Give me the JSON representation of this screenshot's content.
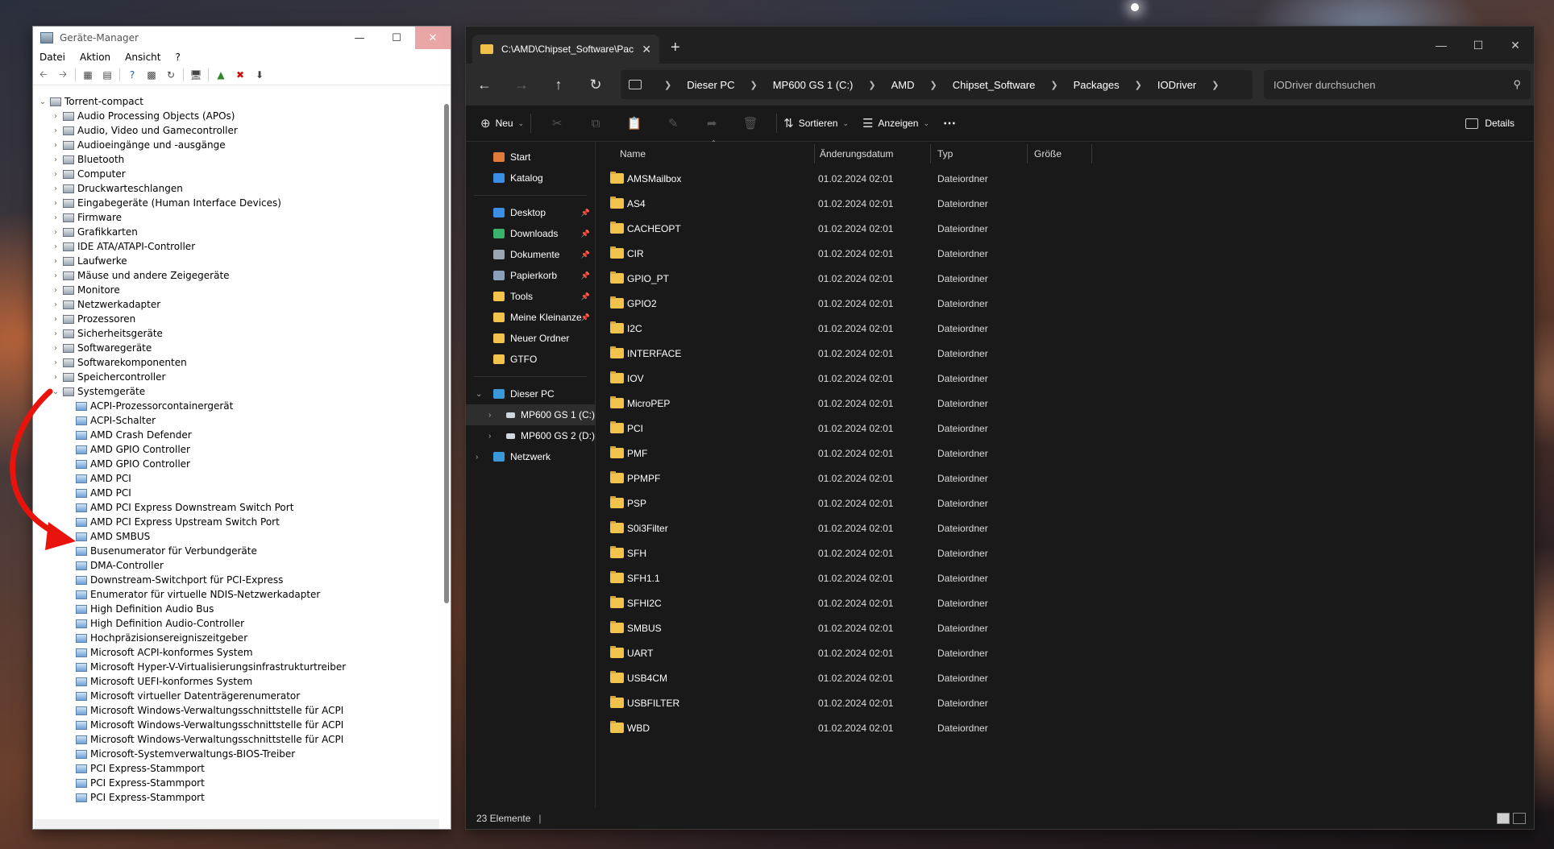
{
  "device_manager": {
    "title": "Geräte-Manager",
    "menu": [
      "Datei",
      "Aktion",
      "Ansicht",
      "?"
    ],
    "root": "Torrent-compact",
    "categories": [
      "Audio Processing Objects (APOs)",
      "Audio, Video und Gamecontroller",
      "Audioeingänge und -ausgänge",
      "Bluetooth",
      "Computer",
      "Druckwarteschlangen",
      "Eingabegeräte (Human Interface Devices)",
      "Firmware",
      "Grafikkarten",
      "IDE ATA/ATAPI-Controller",
      "Laufwerke",
      "Mäuse und andere Zeigegeräte",
      "Monitore",
      "Netzwerkadapter",
      "Prozessoren",
      "Sicherheitsgeräte",
      "Softwaregeräte",
      "Softwarekomponenten",
      "Speichercontroller"
    ],
    "expanded_category": "Systemgeräte",
    "system_devices": [
      "ACPI-Prozessorcontainergerät",
      "ACPI-Schalter",
      "AMD Crash Defender",
      "AMD GPIO Controller",
      "AMD GPIO Controller",
      "AMD PCI",
      "AMD PCI",
      "AMD PCI Express Downstream Switch Port",
      "AMD PCI Express Upstream Switch Port",
      "AMD SMBUS",
      "Busenumerator für Verbundgeräte",
      "DMA-Controller",
      "Downstream-Switchport für PCI-Express",
      "Enumerator für virtuelle NDIS-Netzwerkadapter",
      "High Definition Audio Bus",
      "High Definition Audio-Controller",
      "Hochpräzisionsereigniszeitgeber",
      "Microsoft ACPI-konformes System",
      "Microsoft Hyper-V-Virtualisierungsinfrastrukturtreiber",
      "Microsoft UEFI-konformes System",
      "Microsoft virtueller Datenträgerenumerator",
      "Microsoft Windows-Verwaltungsschnittstelle für ACPI",
      "Microsoft Windows-Verwaltungsschnittstelle für ACPI",
      "Microsoft Windows-Verwaltungsschnittstelle für ACPI",
      "Microsoft-Systemverwaltungs-BIOS-Treiber",
      "PCI Express-Stammport",
      "PCI Express-Stammport",
      "PCI Express-Stammport"
    ]
  },
  "explorer": {
    "tab_title": "C:\\AMD\\Chipset_Software\\Pac",
    "breadcrumb": [
      "Dieser PC",
      "MP600 GS 1 (C:)",
      "AMD",
      "Chipset_Software",
      "Packages",
      "IODriver"
    ],
    "search_placeholder": "IODriver durchsuchen",
    "toolbar": {
      "new": "Neu",
      "sort": "Sortieren",
      "view": "Anzeigen",
      "details": "Details"
    },
    "nav_pane": {
      "top": [
        "Start",
        "Katalog"
      ],
      "quick": [
        {
          "label": "Desktop",
          "pinned": true,
          "color": "#3a8ee6"
        },
        {
          "label": "Downloads",
          "pinned": true,
          "color": "#3bb26b"
        },
        {
          "label": "Dokumente",
          "pinned": true,
          "color": "#9aa6b2"
        },
        {
          "label": "Papierkorb",
          "pinned": true,
          "color": "#8aa0b8"
        },
        {
          "label": "Tools",
          "pinned": true,
          "color": "#f1c24c"
        },
        {
          "label": "Meine Kleinanze",
          "pinned": true,
          "color": "#f1c24c"
        },
        {
          "label": "Neuer Ordner",
          "pinned": false,
          "color": "#f1c24c"
        },
        {
          "label": "GTFO",
          "pinned": false,
          "color": "#f1c24c"
        }
      ],
      "this_pc": "Dieser PC",
      "drives": [
        "MP600 GS 1 (C:)",
        "MP600 GS 2 (D:)"
      ],
      "network": "Netzwerk"
    },
    "columns": [
      "Name",
      "Änderungsdatum",
      "Typ",
      "Größe"
    ],
    "files": [
      {
        "name": "AMSMailbox",
        "date": "01.02.2024 02:01",
        "type": "Dateiordner"
      },
      {
        "name": "AS4",
        "date": "01.02.2024 02:01",
        "type": "Dateiordner"
      },
      {
        "name": "CACHEOPT",
        "date": "01.02.2024 02:01",
        "type": "Dateiordner"
      },
      {
        "name": "CIR",
        "date": "01.02.2024 02:01",
        "type": "Dateiordner"
      },
      {
        "name": "GPIO_PT",
        "date": "01.02.2024 02:01",
        "type": "Dateiordner"
      },
      {
        "name": "GPIO2",
        "date": "01.02.2024 02:01",
        "type": "Dateiordner"
      },
      {
        "name": "I2C",
        "date": "01.02.2024 02:01",
        "type": "Dateiordner"
      },
      {
        "name": "INTERFACE",
        "date": "01.02.2024 02:01",
        "type": "Dateiordner"
      },
      {
        "name": "IOV",
        "date": "01.02.2024 02:01",
        "type": "Dateiordner"
      },
      {
        "name": "MicroPEP",
        "date": "01.02.2024 02:01",
        "type": "Dateiordner"
      },
      {
        "name": "PCI",
        "date": "01.02.2024 02:01",
        "type": "Dateiordner"
      },
      {
        "name": "PMF",
        "date": "01.02.2024 02:01",
        "type": "Dateiordner"
      },
      {
        "name": "PPMPF",
        "date": "01.02.2024 02:01",
        "type": "Dateiordner"
      },
      {
        "name": "PSP",
        "date": "01.02.2024 02:01",
        "type": "Dateiordner"
      },
      {
        "name": "S0i3Filter",
        "date": "01.02.2024 02:01",
        "type": "Dateiordner"
      },
      {
        "name": "SFH",
        "date": "01.02.2024 02:01",
        "type": "Dateiordner"
      },
      {
        "name": "SFH1.1",
        "date": "01.02.2024 02:01",
        "type": "Dateiordner"
      },
      {
        "name": "SFHI2C",
        "date": "01.02.2024 02:01",
        "type": "Dateiordner"
      },
      {
        "name": "SMBUS",
        "date": "01.02.2024 02:01",
        "type": "Dateiordner"
      },
      {
        "name": "UART",
        "date": "01.02.2024 02:01",
        "type": "Dateiordner"
      },
      {
        "name": "USB4CM",
        "date": "01.02.2024 02:01",
        "type": "Dateiordner"
      },
      {
        "name": "USBFILTER",
        "date": "01.02.2024 02:01",
        "type": "Dateiordner"
      },
      {
        "name": "WBD",
        "date": "01.02.2024 02:01",
        "type": "Dateiordner"
      }
    ],
    "status": "23 Elemente"
  }
}
